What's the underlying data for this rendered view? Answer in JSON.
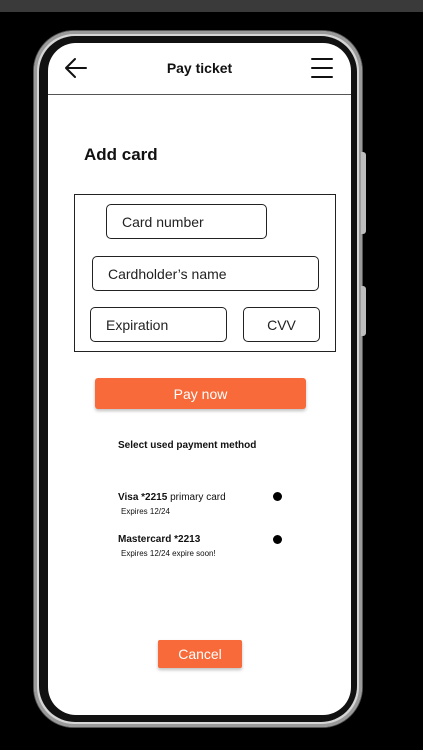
{
  "header": {
    "back_icon": "arrow-left-icon",
    "title": "Pay ticket",
    "menu_icon": "hamburger-menu-icon"
  },
  "add_card": {
    "title": "Add card",
    "card_number_placeholder": "Card number",
    "cardholder_placeholder": "Cardholder’s name",
    "expiration_placeholder": "Expiration",
    "cvv_placeholder": "CVV"
  },
  "pay_button": {
    "label": "Pay now"
  },
  "payment_methods": {
    "title": "Select used payment method",
    "items": [
      {
        "name": "Visa *2215",
        "note": " primary card",
        "expires": "Expires 12/24"
      },
      {
        "name": "Mastercard *2213",
        "note": "",
        "expires": "Expires 12/24  expire soon!"
      }
    ]
  },
  "cancel_button": {
    "label": "Cancel"
  },
  "colors": {
    "accent": "#f86a3a",
    "background": "#000000",
    "screen": "#ffffff"
  }
}
